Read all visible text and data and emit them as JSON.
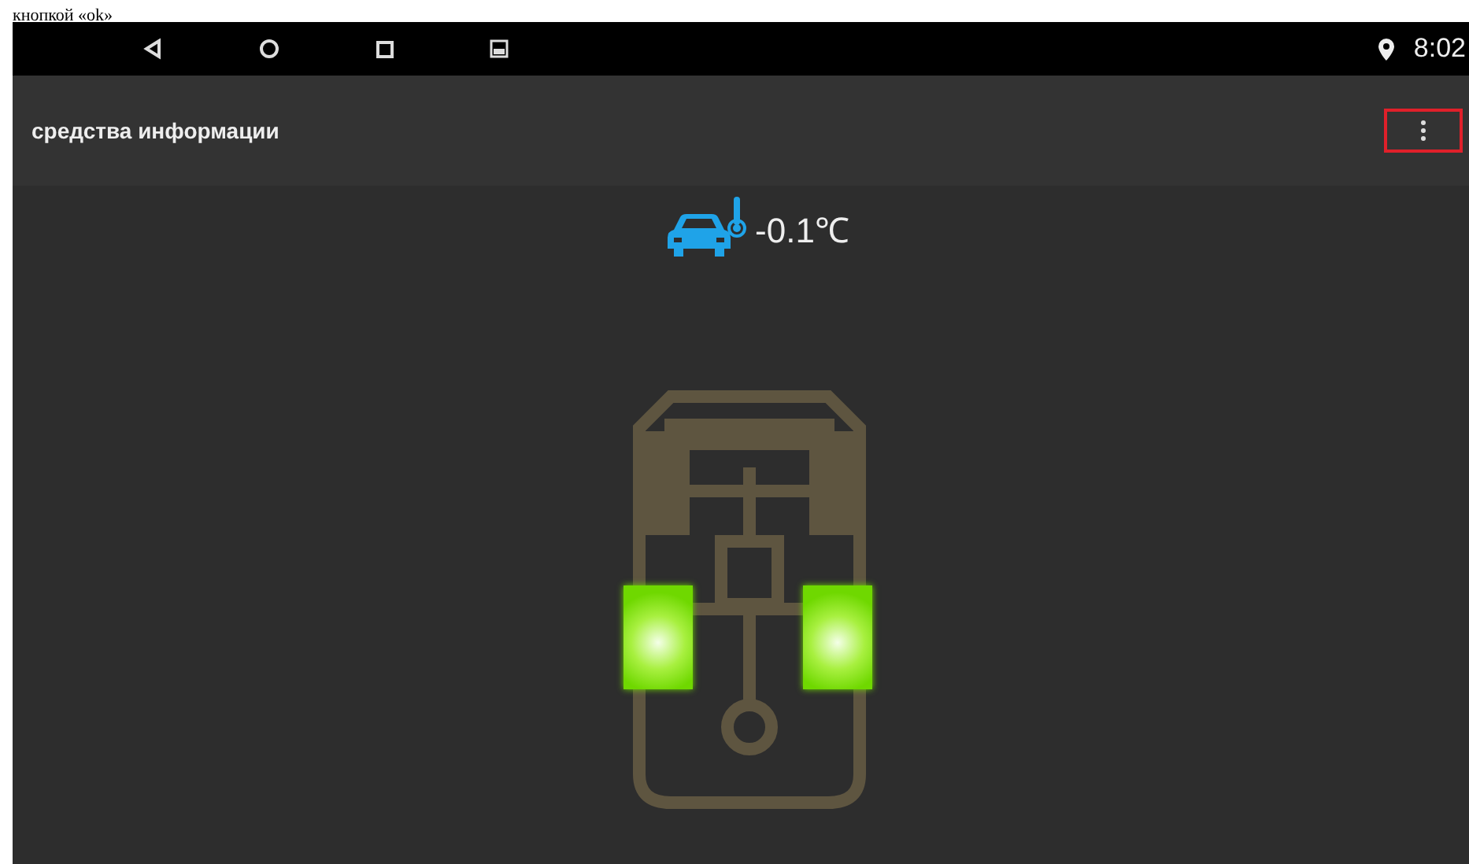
{
  "caption_fragment": "кнопкой «ok»",
  "status_bar": {
    "time": "8:02"
  },
  "app_bar": {
    "title": "средства информации",
    "menu_highlighted": true
  },
  "temperature": {
    "reading": "-0.1℃"
  },
  "wheels": [
    {
      "lit": false
    },
    {
      "lit": false
    },
    {
      "lit": true
    },
    {
      "lit": true
    }
  ]
}
